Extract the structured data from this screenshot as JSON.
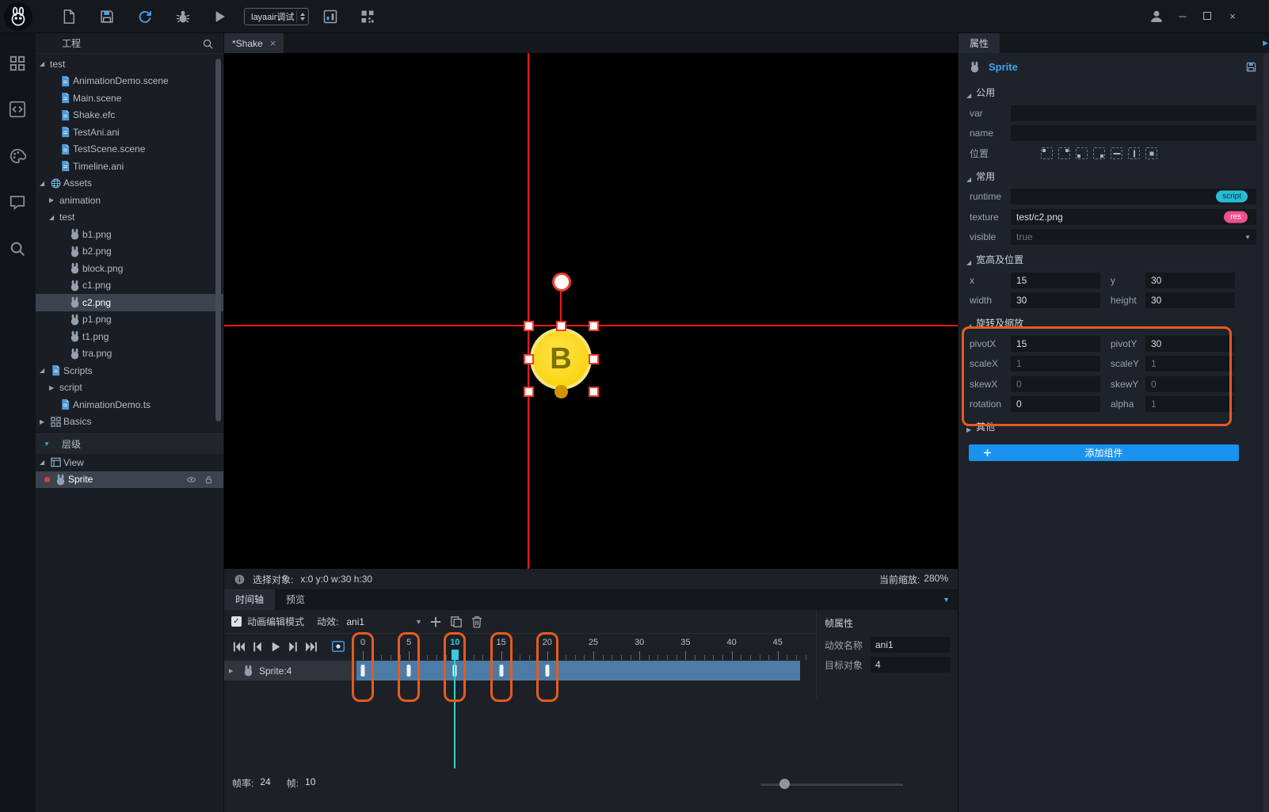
{
  "colors": {
    "accent_blue": "#1a93f0",
    "annotation_orange": "#e55b1f",
    "timeline_track_blue": "#4d7ba6",
    "current_frame_cyan": "#3cc8e2",
    "crosshair_red": "#f01818",
    "sprite_yellow": "#ffd400",
    "script_badge": "#27bcd4",
    "res_badge": "#f0508e"
  },
  "toolbar": {
    "dropdown_value": "layaair调试"
  },
  "project": {
    "title": "工程",
    "tree": [
      {
        "label": "test",
        "level": 0,
        "expanded": true
      },
      {
        "label": "AnimationDemo.scene",
        "level": 1,
        "icon": "doc"
      },
      {
        "label": "Main.scene",
        "level": 1,
        "icon": "doc"
      },
      {
        "label": "Shake.efc",
        "level": 1,
        "icon": "doc"
      },
      {
        "label": "TestAni.ani",
        "level": 1,
        "icon": "doc"
      },
      {
        "label": "TestScene.scene",
        "level": 1,
        "icon": "doc"
      },
      {
        "label": "Timeline.ani",
        "level": 1,
        "icon": "doc"
      },
      {
        "label": "Assets",
        "level": 0,
        "expanded": true,
        "icon": "globe"
      },
      {
        "label": "animation",
        "level": 1,
        "expanded": false
      },
      {
        "label": "test",
        "level": 1,
        "expanded": true
      },
      {
        "label": "b1.png",
        "level": 2,
        "icon": "rabbit"
      },
      {
        "label": "b2.png",
        "level": 2,
        "icon": "rabbit"
      },
      {
        "label": "block.png",
        "level": 2,
        "icon": "rabbit"
      },
      {
        "label": "c1.png",
        "level": 2,
        "icon": "rabbit"
      },
      {
        "label": "c2.png",
        "level": 2,
        "icon": "rabbit",
        "selected": true
      },
      {
        "label": "p1.png",
        "level": 2,
        "icon": "rabbit"
      },
      {
        "label": "t1.png",
        "level": 2,
        "icon": "rabbit"
      },
      {
        "label": "tra.png",
        "level": 2,
        "icon": "rabbit"
      },
      {
        "label": "Scripts",
        "level": 0,
        "expanded": true,
        "icon": "doc"
      },
      {
        "label": "script",
        "level": 1,
        "expanded": false
      },
      {
        "label": "AnimationDemo.ts",
        "level": 1,
        "icon": "doc"
      },
      {
        "label": "Basics",
        "level": 0,
        "expanded": false,
        "icon": "grid"
      }
    ]
  },
  "hierarchy": {
    "title": "层级",
    "items": [
      {
        "label": "View",
        "expanded": true
      },
      {
        "label": "Sprite",
        "selected": true
      }
    ]
  },
  "scene": {
    "tab_title": "*Shake",
    "tab_close": "×",
    "sprite_label": "B",
    "status_label": "选择对象:",
    "status_value": "x:0 y:0  w:30 h:30",
    "zoom_label": "当前缩放:",
    "zoom_value": "280%"
  },
  "timeline": {
    "tab_timeline": "时间轴",
    "tab_preview": "预览",
    "edit_mode_label": "动画编辑模式",
    "anim_label": "动效:",
    "anim_value": "ani1",
    "ruler": [
      "0",
      "5",
      "10",
      "15",
      "20",
      "25",
      "30",
      "35",
      "40",
      "45"
    ],
    "current_frame": "10",
    "track": {
      "name": "Sprite:4",
      "keyframes": [
        0,
        5,
        10,
        15,
        20
      ]
    },
    "fps_label": "帧率:",
    "fps_value": "24",
    "frame_label": "帧:",
    "frame_value": "10"
  },
  "frame_props": {
    "title": "帧属性",
    "name_label": "动效名称",
    "name_value": "ani1",
    "target_label": "目标对象",
    "target_value": "4"
  },
  "properties": {
    "tab": "属性",
    "component_name": "Sprite",
    "sections": {
      "common": "公用",
      "general": "常用",
      "size": "宽高及位置",
      "transform": "旋转及缩放",
      "other": "其他"
    },
    "fields": {
      "var_label": "var",
      "name_label": "name",
      "pos_label": "位置",
      "runtime_label": "runtime",
      "runtime_badge": "script",
      "texture_label": "texture",
      "texture_value": "test/c2.png",
      "texture_badge": "res",
      "visible_label": "visible",
      "visible_value": "true",
      "x_label": "x",
      "x_value": "15",
      "y_label": "y",
      "y_value": "30",
      "width_label": "width",
      "width_value": "30",
      "height_label": "height",
      "height_value": "30",
      "pivotx_label": "pivotX",
      "pivotx_value": "15",
      "pivoty_label": "pivotY",
      "pivoty_value": "30",
      "scalex_label": "scaleX",
      "scalex_value": "1",
      "scaley_label": "scaleY",
      "scaley_value": "1",
      "skewx_label": "skewX",
      "skewx_value": "0",
      "skewy_label": "skewY",
      "skewy_value": "0",
      "rotation_label": "rotation",
      "rotation_value": "0",
      "alpha_label": "alpha",
      "alpha_value": "1"
    },
    "add_component": "添加组件"
  }
}
